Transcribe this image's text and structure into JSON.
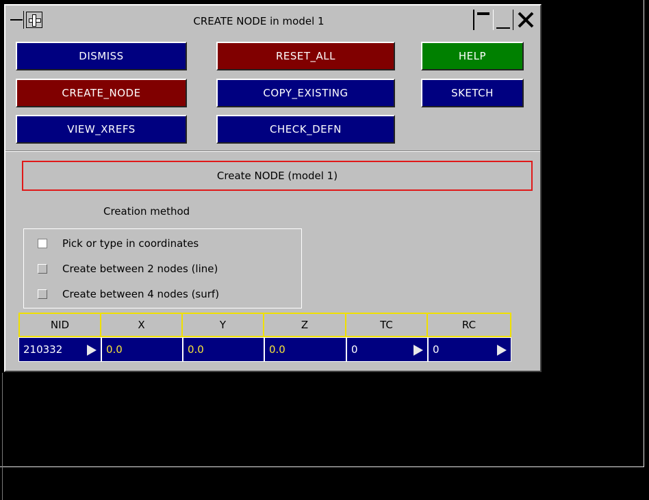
{
  "window": {
    "title": "CREATE NODE in model 1"
  },
  "buttons": {
    "dismiss": "DISMISS",
    "reset_all": "RESET_ALL",
    "help": "HELP",
    "create_node": "CREATE_NODE",
    "copy_existing": "COPY_EXISTING",
    "sketch": "SKETCH",
    "view_xrefs": "VIEW_XREFS",
    "check_defn": "CHECK_DEFN"
  },
  "panel": {
    "heading": "Create NODE (model 1)",
    "method_label": "Creation method",
    "methods": [
      {
        "label": "Pick or type in coordinates",
        "selected": true
      },
      {
        "label": "Create between 2 nodes (line)",
        "selected": false
      },
      {
        "label": "Create between 4 nodes (surf)",
        "selected": false
      }
    ]
  },
  "table": {
    "headers": [
      "NID",
      "X",
      "Y",
      "Z",
      "TC",
      "RC"
    ],
    "values": [
      "210332",
      "0.0",
      "0.0",
      "0.0",
      "0",
      "0"
    ]
  },
  "colors": {
    "button_blue": "#000080",
    "button_red": "#800000",
    "button_green": "#008000",
    "panel_gray": "#c0c0c0",
    "heading_border": "#e01818",
    "grid_border": "#f0e000"
  }
}
